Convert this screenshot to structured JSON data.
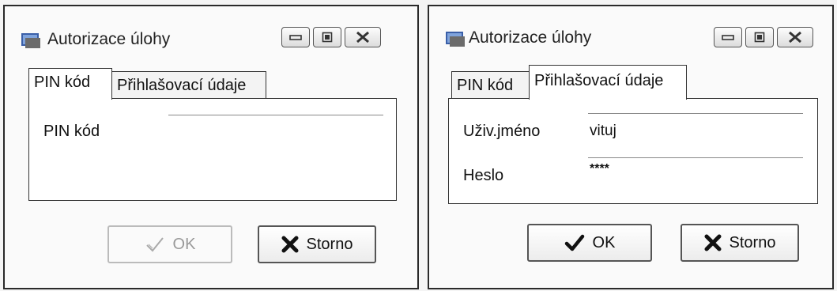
{
  "dialog_left": {
    "title": "Autorizace úlohy",
    "tabs": [
      "PIN kód",
      "Přihlašovací údaje"
    ],
    "active_tab": "PIN kód",
    "pin_label": "PIN kód",
    "pin_value": "",
    "ok_label": "OK",
    "ok_enabled": false,
    "cancel_label": "Storno"
  },
  "dialog_right": {
    "title": "Autorizace úlohy",
    "tabs": [
      "PIN kód",
      "Přihlašovací údaje"
    ],
    "active_tab": "Přihlašovací údaje",
    "username_label": "Uživ.jméno",
    "username_value": "vituj",
    "password_label": "Heslo",
    "password_value": "****",
    "ok_label": "OK",
    "ok_enabled": true,
    "cancel_label": "Storno"
  },
  "icons": {
    "app": "app-window-icon",
    "minimize": "minimize-icon",
    "maximize": "maximize-icon",
    "close": "close-icon",
    "ok": "checkmark-icon",
    "cancel": "x-icon"
  }
}
